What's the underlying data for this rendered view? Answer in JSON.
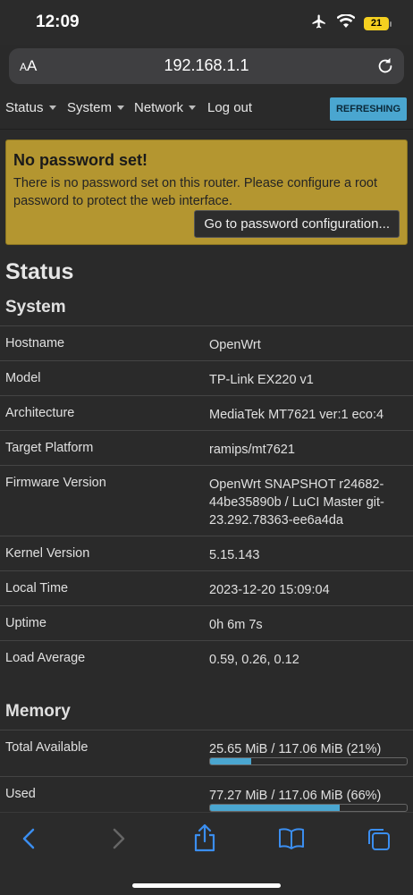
{
  "statusbar": {
    "time": "12:09",
    "battery": "21"
  },
  "browser": {
    "aa_label_small": "A",
    "aa_label_big": "A",
    "url": "192.168.1.1"
  },
  "nav": {
    "items": [
      "Status",
      "System",
      "Network"
    ],
    "logout": "Log out",
    "refresh_badge": "REFRESHING"
  },
  "alert": {
    "title": "No password set!",
    "message": "There is no password set on this router. Please configure a root password to protect the web interface.",
    "button": "Go to password configuration..."
  },
  "page_title": "Status",
  "system": {
    "heading": "System",
    "rows": [
      {
        "label": "Hostname",
        "value": "OpenWrt"
      },
      {
        "label": "Model",
        "value": "TP-Link EX220 v1"
      },
      {
        "label": "Architecture",
        "value": "MediaTek MT7621 ver:1 eco:4"
      },
      {
        "label": "Target Platform",
        "value": "ramips/mt7621"
      },
      {
        "label": "Firmware Version",
        "value": "OpenWrt SNAPSHOT r24682-44be35890b / LuCI Master git-23.292.78363-ee6a4da"
      },
      {
        "label": "Kernel Version",
        "value": "5.15.143"
      },
      {
        "label": "Local Time",
        "value": "2023-12-20 15:09:04"
      },
      {
        "label": "Uptime",
        "value": "0h 6m 7s"
      },
      {
        "label": "Load Average",
        "value": "0.59, 0.26, 0.12"
      }
    ]
  },
  "memory": {
    "heading": "Memory",
    "rows": [
      {
        "label": "Total Available",
        "value": "25.65 MiB / 117.06 MiB (21%)",
        "percent": 21
      },
      {
        "label": "Used",
        "value": "77.27 MiB / 117.06 MiB (66%)",
        "percent": 66
      }
    ]
  },
  "colors": {
    "accent": "#4aa6d0",
    "alert_bg": "#b49630",
    "page_bg": "#2a2a2a"
  }
}
